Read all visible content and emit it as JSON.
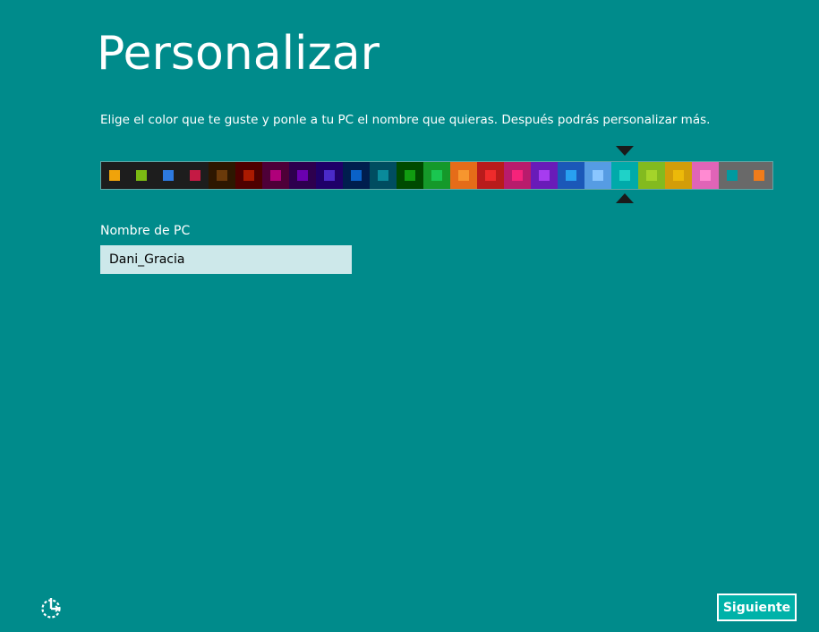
{
  "page": {
    "title": "Personalizar",
    "subtitle": "Elige el color que te guste y ponle a tu PC el nombre que quieras. Después podrás personalizar más."
  },
  "palette": {
    "selected_index": 19,
    "swatches": [
      {
        "bg": "#1d1d1d",
        "chip": "#f0a30a"
      },
      {
        "bg": "#1d1d1d",
        "chip": "#7bba13"
      },
      {
        "bg": "#1d1d1d",
        "chip": "#2d7ae0"
      },
      {
        "bg": "#1d1d1d",
        "chip": "#c41a44"
      },
      {
        "bg": "#2d1700",
        "chip": "#6a3a0a"
      },
      {
        "bg": "#4e0000",
        "chip": "#aa1a00"
      },
      {
        "bg": "#4e0038",
        "chip": "#b0007a"
      },
      {
        "bg": "#2d004e",
        "chip": "#6a00b0"
      },
      {
        "bg": "#1f0068",
        "chip": "#4a2ac8"
      },
      {
        "bg": "#001e4e",
        "chip": "#0a62c8"
      },
      {
        "bg": "#004d60",
        "chip": "#0a8a9a"
      },
      {
        "bg": "#004a00",
        "chip": "#119c11"
      },
      {
        "bg": "#15992a",
        "chip": "#1ac650"
      },
      {
        "bg": "#e56c19",
        "chip": "#f7962e"
      },
      {
        "bg": "#b81b1b",
        "chip": "#ee2b2b"
      },
      {
        "bg": "#b81b6c",
        "chip": "#f5237a"
      },
      {
        "bg": "#691bb8",
        "chip": "#a63cf0"
      },
      {
        "bg": "#1b58b8",
        "chip": "#28a0f0"
      },
      {
        "bg": "#569ce3",
        "chip": "#8ac6ff"
      },
      {
        "bg": "#00aaaa",
        "chip": "#1fd2c8"
      },
      {
        "bg": "#83ba1f",
        "chip": "#a4d42a"
      },
      {
        "bg": "#d39d09",
        "chip": "#ecb909"
      },
      {
        "bg": "#e064b7",
        "chip": "#ff8ad2"
      },
      {
        "bg": "#696969",
        "chip": "#009aa0"
      },
      {
        "bg": "#696969",
        "chip": "#f07c1a"
      }
    ]
  },
  "pc_name": {
    "label": "Nombre de PC",
    "value": "Dani_Gracia"
  },
  "footer": {
    "next_label": "Siguiente",
    "accessibility_icon": "ease-of-access-icon"
  },
  "colors": {
    "background": "#008b8b",
    "accent": "#00b2a9"
  }
}
